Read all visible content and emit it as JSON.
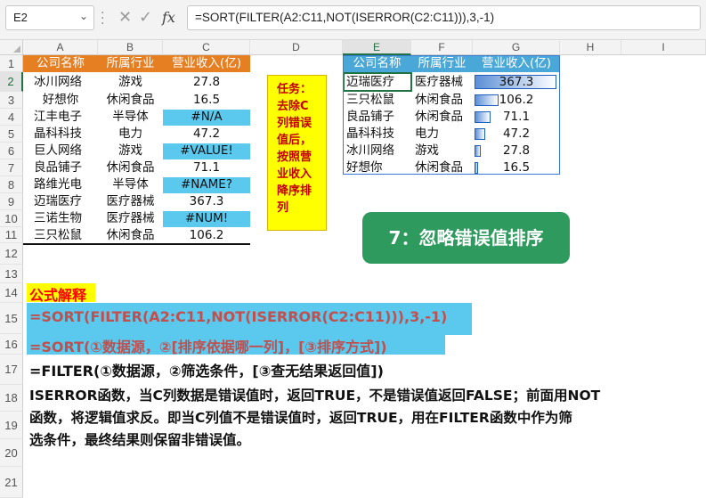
{
  "formula_bar": {
    "name_box": "E2",
    "cancel_icon": "✕",
    "enter_icon": "✓",
    "fx_label": "fx",
    "formula": "=SORT(FILTER(A2:C11,NOT(ISERROR(C2:C11))),3,-1)"
  },
  "columns": [
    "A",
    "B",
    "C",
    "D",
    "E",
    "F",
    "G",
    "H",
    "I"
  ],
  "rows": [
    "1",
    "2",
    "3",
    "4",
    "5",
    "6",
    "7",
    "8",
    "9",
    "10",
    "11",
    "12",
    "13",
    "14",
    "15",
    "16",
    "17",
    "18",
    "19",
    "20",
    "21"
  ],
  "source_table": {
    "headers": [
      "公司名称",
      "所属行业",
      "营业收入(亿)"
    ],
    "rows": [
      [
        "冰川网络",
        "游戏",
        "27.8"
      ],
      [
        "好想你",
        "休闲食品",
        "16.5"
      ],
      [
        "江丰电子",
        "半导体",
        "#N/A"
      ],
      [
        "晶科科技",
        "电力",
        "47.2"
      ],
      [
        "巨人网络",
        "游戏",
        "#VALUE!"
      ],
      [
        "良品铺子",
        "休闲食品",
        "71.1"
      ],
      [
        "路维光电",
        "半导体",
        "#NAME?"
      ],
      [
        "迈瑞医疗",
        "医疗器械",
        "367.3"
      ],
      [
        "三诺生物",
        "医疗器械",
        "#NUM!"
      ],
      [
        "三只松鼠",
        "休闲食品",
        "106.2"
      ]
    ]
  },
  "task_note": {
    "lines": [
      "任务：",
      "去除C",
      "列错误",
      "值后，",
      "按照营",
      "业收入",
      "降序排",
      "列"
    ]
  },
  "result_table": {
    "headers": [
      "公司名称",
      "所属行业",
      "营业收入(亿)"
    ],
    "rows": [
      [
        "迈瑞医疗",
        "医疗器械",
        "367.3"
      ],
      [
        "三只松鼠",
        "休闲食品",
        "106.2"
      ],
      [
        "良品铺子",
        "休闲食品",
        "71.1"
      ],
      [
        "晶科科技",
        "电力",
        "47.2"
      ],
      [
        "冰川网络",
        "游戏",
        "27.8"
      ],
      [
        "好想你",
        "休闲食品",
        "16.5"
      ]
    ],
    "bar_fraction": [
      1.0,
      0.289,
      0.194,
      0.129,
      0.076,
      0.045
    ]
  },
  "banner": "7：忽略错误值排序",
  "explanation": {
    "title": "公式解释",
    "formula": "=SORT(FILTER(A2:C11,NOT(ISERROR(C2:C11))),3,-1)",
    "sort_syntax": "=SORT(①数据源，②[排序依据哪一列]，[③排序方式])",
    "filter_syntax": "=FILTER(①数据源，②筛选条件，[③查无结果返回值])",
    "desc_lines": [
      "ISERROR函数，当C列数据是错误值时，返回TRUE，不是错误值返回FALSE；前面用NOT",
      "函数，将逻辑值求反。即当C列值不是错误值时，返回TRUE，用在FILTER函数中作为筛",
      "选条件，最终结果则保留非错误值。"
    ]
  },
  "colors": {
    "orange_header": "#e67e22",
    "blue_header": "#4aa8d8",
    "error_fill": "#5bc8ee",
    "task_fill": "#ffff00",
    "banner_fill": "#2e9a5e",
    "title_red": "#ff0000",
    "syntax_orange": "#c0504d"
  }
}
